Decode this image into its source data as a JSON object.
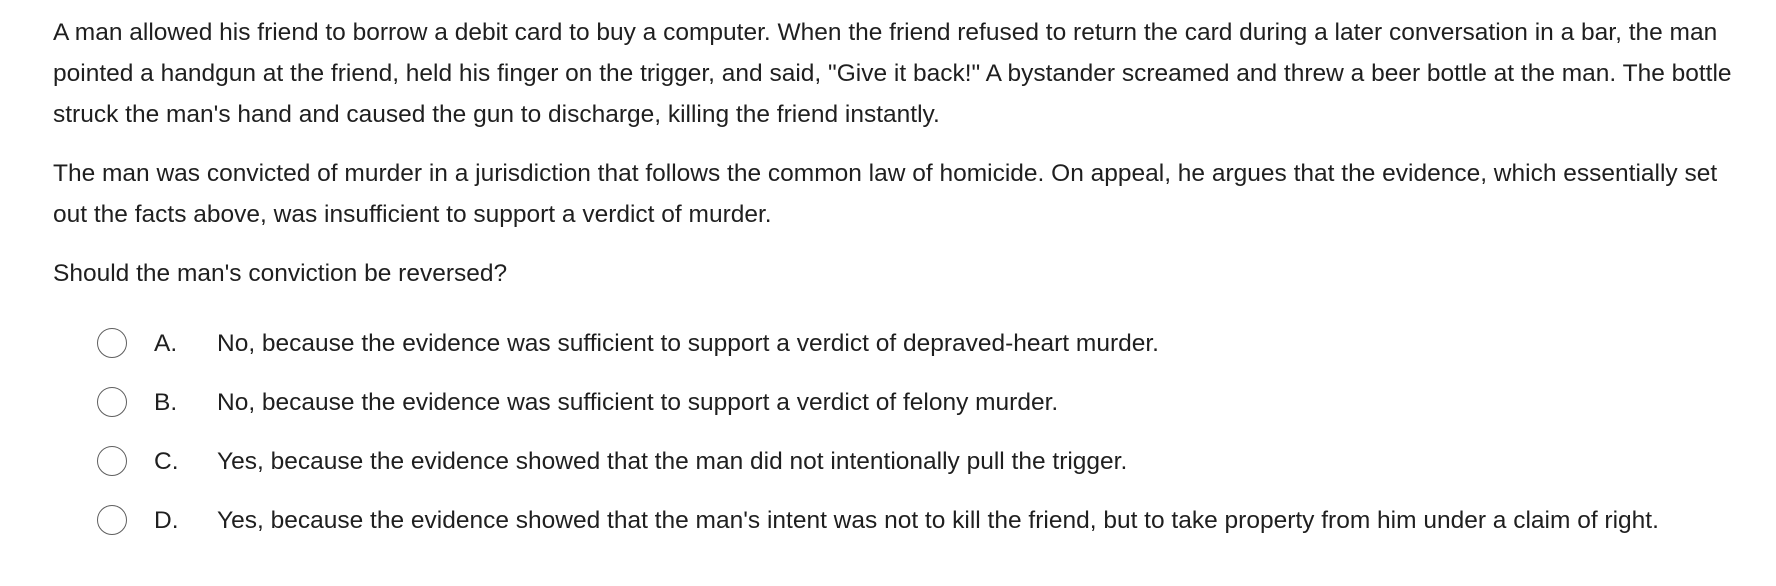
{
  "question": {
    "paragraphs": [
      "A man allowed his friend to borrow a debit card to buy a computer.  When the friend refused to return the card during a later conversation in a bar, the man pointed a handgun at the friend, held his finger on the trigger, and said, \"Give it back!\"  A bystander screamed and threw a beer bottle at the man.  The bottle struck the man's hand and caused the gun to discharge, killing the friend instantly.",
      "The man was convicted of murder in a jurisdiction that follows the common law of homicide.  On appeal, he argues that the evidence, which essentially set out the facts above, was insufficient to support a verdict of murder.",
      "Should the man's conviction be reversed?"
    ]
  },
  "options": [
    {
      "letter": "A.",
      "text": "No, because the evidence was sufficient to support a verdict of depraved-heart murder.",
      "selected": false
    },
    {
      "letter": "B.",
      "text": "No, because the evidence was sufficient to support a verdict of felony murder.",
      "selected": false
    },
    {
      "letter": "C.",
      "text": "Yes, because the evidence showed that the man did not intentionally pull the trigger.",
      "selected": false
    },
    {
      "letter": "D.",
      "text": "Yes, because the evidence showed that the man's intent was not to kill the friend, but to take property from him under a claim of right.",
      "selected": false
    }
  ],
  "icons": {
    "radio": "radio-button-unselected-icon"
  }
}
